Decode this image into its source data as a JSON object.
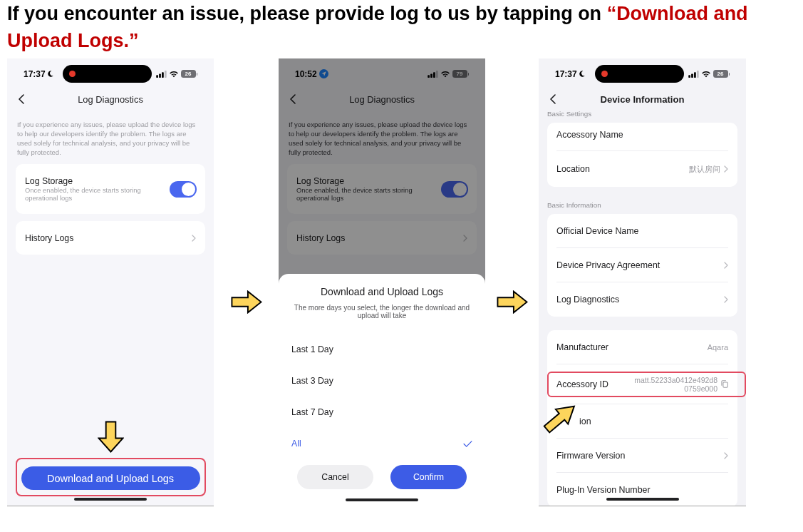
{
  "heading": {
    "text": "If you encounter an issue, please provide log to us by tapping on ",
    "highlight": "“Download and Upload Logs.”"
  },
  "phones": [
    {
      "kind": "diagnostics",
      "dimmed": false,
      "status_bar": {
        "time": "17:37",
        "time_icon": {
          "kind": "moon"
        },
        "island": true,
        "battery": "26"
      },
      "title": "Log Diagnostics",
      "description": "If you experience any issues, please upload the device logs to help our developers identify the problem. The logs are used solely for technical analysis, and your privacy will be fully protected.",
      "cards": [
        {
          "kind": "toggle",
          "label": "Log Storage",
          "sublabel": "Once enabled, the device starts storing operational logs",
          "on": true
        },
        {
          "kind": "link",
          "label": "History Logs"
        }
      ],
      "primary_button": {
        "label": "Download and Upload Logs",
        "highlighted": true,
        "arrow": true
      }
    },
    {
      "kind": "diagnostics",
      "dimmed": true,
      "status_bar": {
        "time": "10:52",
        "time_icon": {
          "kind": "location"
        },
        "island": false,
        "battery": "79"
      },
      "title": "Log Diagnostics",
      "description": "If you experience any issues, please upload the device logs to help our developers identify the problem. The logs are used solely for technical analysis, and your privacy will be fully protected.",
      "cards": [
        {
          "kind": "toggle",
          "label": "Log Storage",
          "sublabel": "Once enabled, the device starts storing operational logs",
          "on": true
        },
        {
          "kind": "link",
          "label": "History Logs"
        }
      ],
      "sheet": {
        "title": "Download and Upload Logs",
        "subtitle": "The more days you select, the longer the download and upload will take",
        "options": [
          {
            "label": "Last 1 Day",
            "selected": false
          },
          {
            "label": "Last 3 Day",
            "selected": false
          },
          {
            "label": "Last 7 Day",
            "selected": false
          },
          {
            "label": "All",
            "selected": true
          }
        ],
        "buttons": [
          {
            "label": "Cancel",
            "kind": "secondary"
          },
          {
            "label": "Confirm",
            "kind": "primary"
          }
        ]
      }
    },
    {
      "kind": "details",
      "dimmed": false,
      "status_bar": {
        "time": "17:37",
        "time_icon": {
          "kind": "moon"
        },
        "island": true,
        "battery": "26"
      },
      "title": "Device Information",
      "sections": [
        {
          "title": "Basic Settings",
          "rows": [
            {
              "label": "Accessory Name",
              "kind": "plain"
            },
            {
              "label": "Location",
              "value": "默认房间",
              "kind": "nav"
            }
          ]
        },
        {
          "title": "Basic Information",
          "rows": [
            {
              "label": "Official Device Name",
              "kind": "plain"
            },
            {
              "label": "Device Privacy Agreement",
              "kind": "nav"
            },
            {
              "label": "Log Diagnostics",
              "kind": "nav"
            }
          ]
        },
        {
          "rows": [
            {
              "label": "Manufacturer",
              "value": "Aqara",
              "kind": "plain",
              "highlighted": false,
              "arrow": false
            },
            {
              "label": "Accessory ID",
              "value": "matt.52233a0412e492d80759e000",
              "kind": "copy",
              "highlighted": true,
              "arrow": false
            },
            {
              "label": "ion",
              "kind": "plain",
              "highlighted": false,
              "arrow": true
            },
            {
              "label": "Firmware Version",
              "kind": "nav",
              "highlighted": false,
              "arrow": false
            },
            {
              "label": "Plug-In Version Number",
              "kind": "plain",
              "highlighted": false,
              "arrow": false
            }
          ]
        }
      ]
    }
  ]
}
